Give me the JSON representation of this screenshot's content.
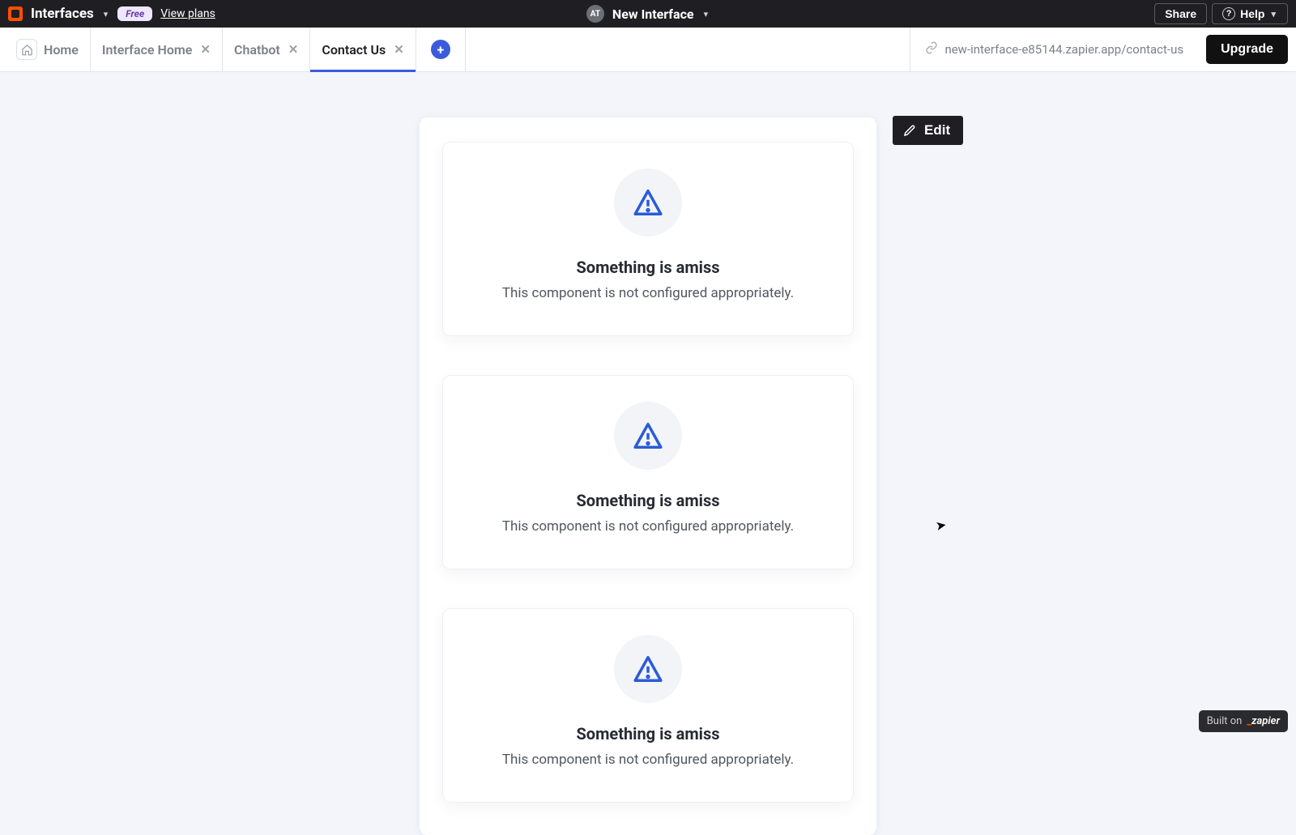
{
  "header": {
    "brand": "Interfaces",
    "free_badge": "Free",
    "view_plans": "View plans",
    "avatar_initials": "AT",
    "project_name": "New Interface",
    "share": "Share",
    "help": "Help"
  },
  "tabs": {
    "home": "Home",
    "items": [
      {
        "label": "Interface Home",
        "active": false
      },
      {
        "label": "Chatbot",
        "active": false
      },
      {
        "label": "Contact Us",
        "active": true
      }
    ],
    "url": "new-interface-e85144.zapier.app/contact-us",
    "upgrade": "Upgrade"
  },
  "canvas": {
    "edit": "Edit",
    "components": [
      {
        "title": "Something is amiss",
        "desc": "This component is not configured appropriately."
      },
      {
        "title": "Something is amiss",
        "desc": "This component is not configured appropriately."
      },
      {
        "title": "Something is amiss",
        "desc": "This component is not configured appropriately."
      }
    ]
  },
  "footer": {
    "built_on": "Built on",
    "zapier": "zapier"
  }
}
